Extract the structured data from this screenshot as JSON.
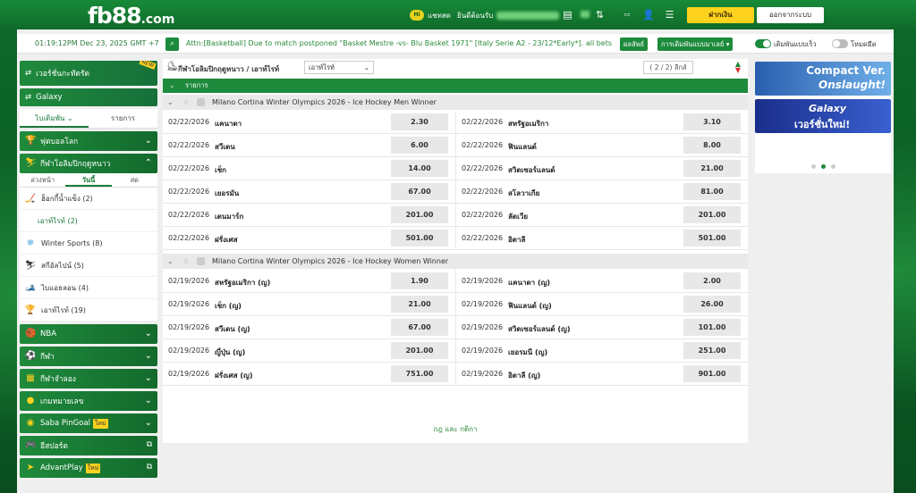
{
  "brand": {
    "logo": "fb88",
    "logo_suffix": ".com"
  },
  "header": {
    "chat_label": "แชทสด",
    "welcome": "ยินดีต้อนรับ",
    "deposit_label": "ฝากเงิน",
    "logout_label": "ออกจากระบบ"
  },
  "ticker": {
    "time": "01:19:12PM Dec 23, 2025 GMT +7",
    "message": "Attn:[Basketball] Due to match postponed \"Basket Mestre -vs- Blu Basket 1971\" [Italy Serie A2 - 23/12*Early*]. all bets",
    "results_label": "ผลลัพธ์",
    "market_label": "การเดิมพันแบบมาเลย์",
    "quick_label": "เดิมพันแบบเร็ว",
    "dark_label": "โหมดมืด"
  },
  "sidebar": {
    "version_label": "เวอร์ชั่นกะทัดรัด",
    "galaxy_label": "Galaxy",
    "tabs": [
      "ไบเดิมพัน",
      "รายการ"
    ],
    "football_label": "ฟุตบอลโลก",
    "winter_label": "กีฬาโอลิมปิกฤดูหนาว",
    "sub_tabs": [
      "ล่วงหน้า",
      "วันนี้",
      "สด"
    ],
    "items": [
      {
        "label": "ฮ็อกกี้น้ำแข็ง",
        "count": "(2)"
      },
      {
        "label": "เอาท์ไรท์",
        "count": "(2)"
      },
      {
        "label": "Winter Sports",
        "count": "(8)"
      },
      {
        "label": "สกีอัลไปน์",
        "count": "(5)"
      },
      {
        "label": "ไบแอธลอน",
        "count": "(4)"
      },
      {
        "label": "เอาท์ไรท์",
        "count": "(19)"
      }
    ],
    "groups": [
      {
        "label": "NBA"
      },
      {
        "label": "กีฬา"
      },
      {
        "label": "กีฬาจำลอง"
      },
      {
        "label": "เกมหมายเลข"
      },
      {
        "label": "Saba PinGoal",
        "badge": "ใหม่"
      },
      {
        "label": "อีสปอร์ต"
      },
      {
        "label": "AdvantPlay",
        "badge": "ใหม่"
      }
    ],
    "new_tag": "NEW"
  },
  "content": {
    "breadcrumb": "กีฬาโอลิมปิกฤดูหนาว / เอาท์ไรท์",
    "select_value": "เอาท์ไรท์",
    "pager": "( 2 / 2) ลีกส์",
    "list_header": "รายการ",
    "rules": "กฎ และ กติกา",
    "events": [
      {
        "title": "Milano Cortina Winter Olympics 2026 - Ice Hockey Men Winner",
        "rows": [
          [
            {
              "d": "02/22/2026",
              "t": "แคนาดา",
              "o": "2.30"
            },
            {
              "d": "02/22/2026",
              "t": "สหรัฐอเมริกา",
              "o": "3.10"
            }
          ],
          [
            {
              "d": "02/22/2026",
              "t": "สวีเดน",
              "o": "6.00"
            },
            {
              "d": "02/22/2026",
              "t": "ฟินแลนด์",
              "o": "8.00"
            }
          ],
          [
            {
              "d": "02/22/2026",
              "t": "เช็ก",
              "o": "14.00"
            },
            {
              "d": "02/22/2026",
              "t": "สวิตเซอร์แลนด์",
              "o": "21.00"
            }
          ],
          [
            {
              "d": "02/22/2026",
              "t": "เยอรมัน",
              "o": "67.00"
            },
            {
              "d": "02/22/2026",
              "t": "สโลวาเกีย",
              "o": "81.00"
            }
          ],
          [
            {
              "d": "02/22/2026",
              "t": "เดนมาร์ก",
              "o": "201.00"
            },
            {
              "d": "02/22/2026",
              "t": "ลัตเวีย",
              "o": "201.00"
            }
          ],
          [
            {
              "d": "02/22/2026",
              "t": "ฝรั่งเศส",
              "o": "501.00"
            },
            {
              "d": "02/22/2026",
              "t": "อิตาลี",
              "o": "501.00"
            }
          ]
        ]
      },
      {
        "title": "Milano Cortina Winter Olympics 2026 - Ice Hockey Women Winner",
        "rows": [
          [
            {
              "d": "02/19/2026",
              "t": "สหรัฐอเมริกา (ญ)",
              "o": "1.90"
            },
            {
              "d": "02/19/2026",
              "t": "แคนาดา (ญ)",
              "o": "2.00"
            }
          ],
          [
            {
              "d": "02/19/2026",
              "t": "เช็ก (ญ)",
              "o": "21.00"
            },
            {
              "d": "02/19/2026",
              "t": "ฟินแลนด์ (ญ)",
              "o": "26.00"
            }
          ],
          [
            {
              "d": "02/19/2026",
              "t": "สวีเดน (ญ)",
              "o": "67.00"
            },
            {
              "d": "02/19/2026",
              "t": "สวิตเซอร์แลนด์ (ญ)",
              "o": "101.00"
            }
          ],
          [
            {
              "d": "02/19/2026",
              "t": "ญี่ปุ่น (ญ)",
              "o": "201.00"
            },
            {
              "d": "02/19/2026",
              "t": "เยอรมนี (ญ)",
              "o": "251.00"
            }
          ],
          [
            {
              "d": "02/19/2026",
              "t": "ฝรั่งเศส (ญ)",
              "o": "751.00"
            },
            {
              "d": "02/19/2026",
              "t": "อิตาลี (ญ)",
              "o": "901.00"
            }
          ]
        ]
      }
    ]
  },
  "promo": {
    "b1_line1": "Compact Ver.",
    "b1_line2": "Onslaught!",
    "b2_line1": "Galaxy",
    "b2_line2": "เวอร์ชั่นใหม่!"
  },
  "colors": {
    "brand_green": "#1d8a3c",
    "accent_yellow": "#ffd21e"
  }
}
